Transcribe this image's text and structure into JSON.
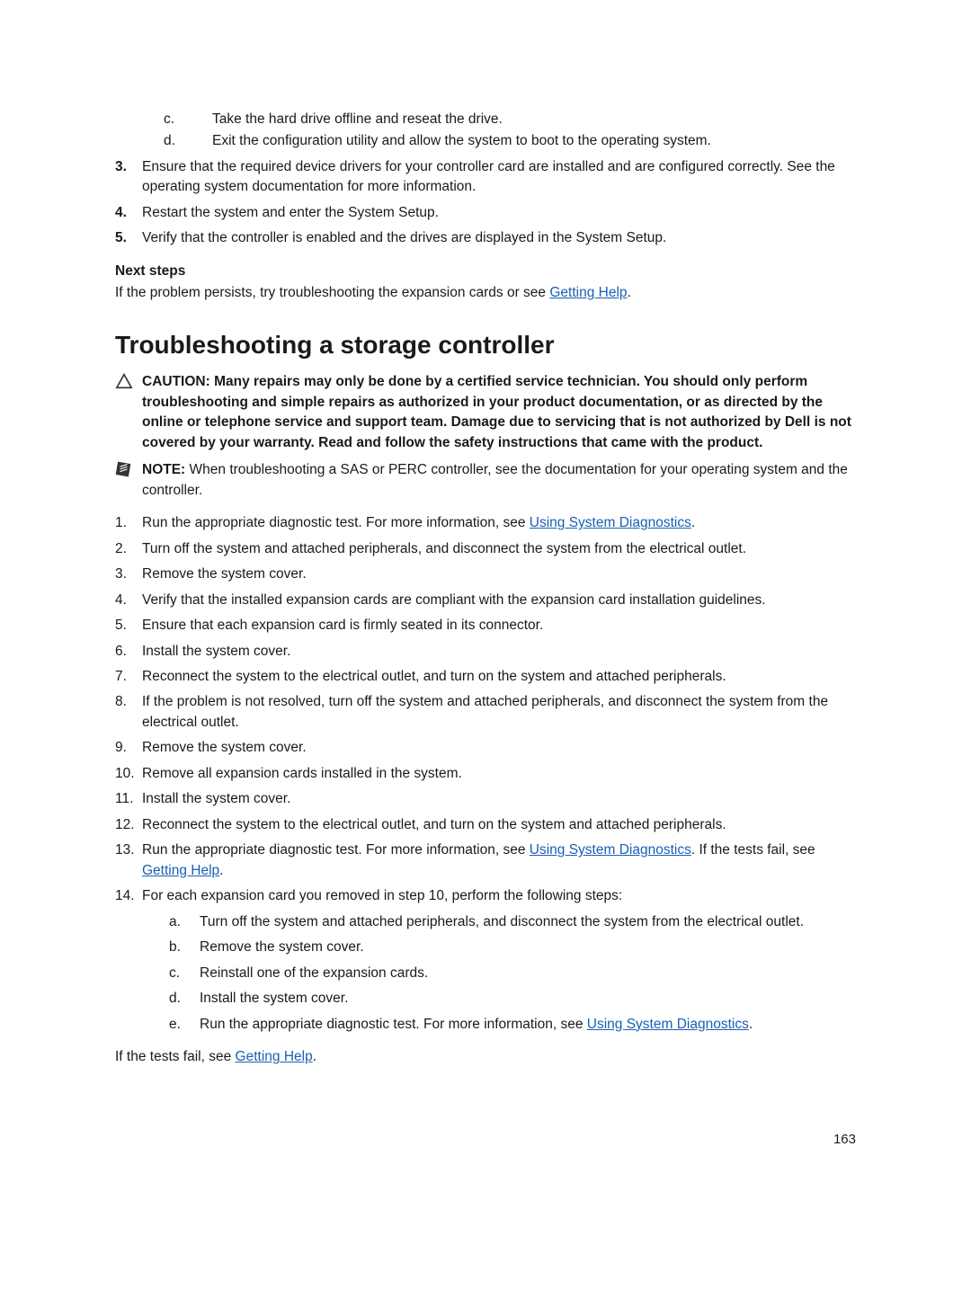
{
  "prev_steps_alpha": [
    {
      "m": "c.",
      "t": "Take the hard drive offline and reseat the drive."
    },
    {
      "m": "d.",
      "t": "Exit the configuration utility and allow the system to boot to the operating system."
    }
  ],
  "prev_steps_num": [
    {
      "m": "3.",
      "t": "Ensure that the required device drivers for your controller card are installed and are configured correctly. See the operating system documentation for more information."
    },
    {
      "m": "4.",
      "t": "Restart the system and enter the System Setup."
    },
    {
      "m": "5.",
      "t": "Verify that the controller is enabled and the drives are displayed in the System Setup."
    }
  ],
  "next_steps_label": "Next steps",
  "next_steps_text_pre": "If the problem persists, try troubleshooting the expansion cards or see ",
  "next_steps_link": "Getting Help",
  "next_steps_text_post": ".",
  "h1": "Troubleshooting a storage controller",
  "caution_label": "CAUTION: ",
  "caution_body": "Many repairs may only be done by a certified service technician. You should only perform troubleshooting and simple repairs as authorized in your product documentation, or as directed by the online or telephone service and support team. Damage due to servicing that is not authorized by Dell is not covered by your warranty. Read and follow the safety instructions that came with the product.",
  "note_label": "NOTE: ",
  "note_body": "When troubleshooting a SAS or PERC controller, see the documentation for your operating system and the controller.",
  "steps": [
    {
      "m": "1.",
      "pre": "Run the appropriate diagnostic test. For more information, see ",
      "link": "Using System Diagnostics",
      "post": "."
    },
    {
      "m": "2.",
      "pre": "Turn off the system and attached peripherals, and disconnect the system from the electrical outlet."
    },
    {
      "m": "3.",
      "pre": "Remove the system cover."
    },
    {
      "m": "4.",
      "pre": "Verify that the installed expansion cards are compliant with the expansion card installation guidelines."
    },
    {
      "m": "5.",
      "pre": "Ensure that each expansion card is firmly seated in its connector."
    },
    {
      "m": "6.",
      "pre": "Install the system cover."
    },
    {
      "m": "7.",
      "pre": "Reconnect the system to the electrical outlet, and turn on the system and attached peripherals."
    },
    {
      "m": "8.",
      "pre": "If the problem is not resolved, turn off the system and attached peripherals, and disconnect the system from the electrical outlet."
    },
    {
      "m": "9.",
      "pre": "Remove the system cover."
    },
    {
      "m": "10.",
      "pre": "Remove all expansion cards installed in the system."
    },
    {
      "m": "11.",
      "pre": "Install the system cover."
    },
    {
      "m": "12.",
      "pre": "Reconnect the system to the electrical outlet, and turn on the system and attached peripherals."
    },
    {
      "m": "13.",
      "pre": "Run the appropriate diagnostic test. For more information, see ",
      "link": "Using System Diagnostics",
      "post": ". If the tests fail, see ",
      "link2": "Getting Help",
      "post2": "."
    },
    {
      "m": "14.",
      "pre": "For each expansion card you removed in step 10, perform the following steps:"
    }
  ],
  "sub14": [
    {
      "m": "a.",
      "t": "Turn off the system and attached peripherals, and disconnect the system from the electrical outlet."
    },
    {
      "m": "b.",
      "t": "Remove the system cover."
    },
    {
      "m": "c.",
      "t": "Reinstall one of the expansion cards."
    },
    {
      "m": "d.",
      "t": "Install the system cover."
    },
    {
      "m": "e.",
      "pre": "Run the appropriate diagnostic test. For more information, see ",
      "link": "Using System Diagnostics",
      "post": "."
    }
  ],
  "closing_pre": "If the tests fail, see ",
  "closing_link": "Getting Help",
  "closing_post": ".",
  "page_num": "163"
}
